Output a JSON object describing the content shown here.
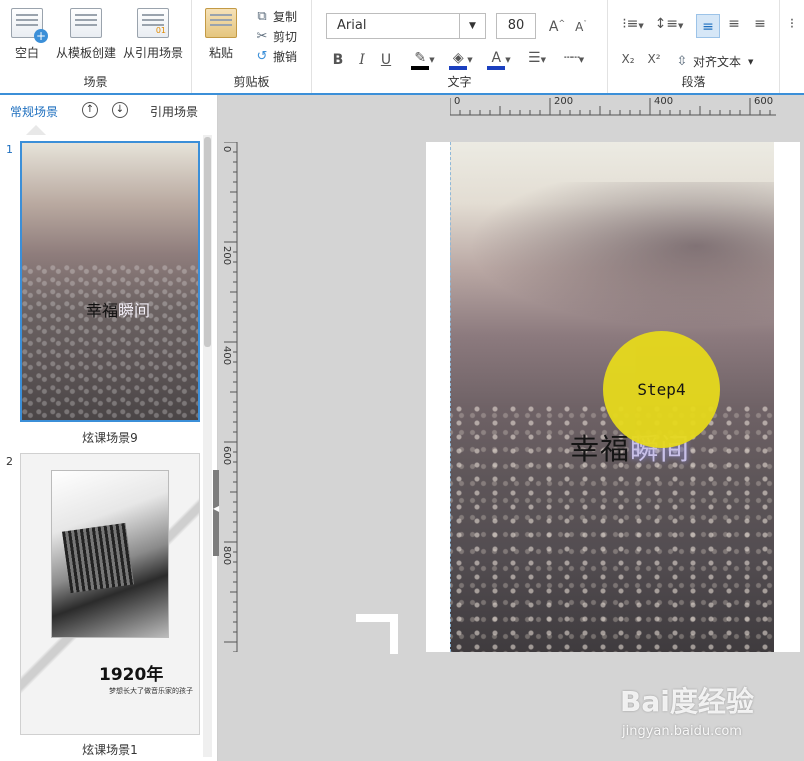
{
  "ribbon": {
    "scene_group": {
      "title": "场景",
      "buttons": [
        {
          "label": "空白",
          "icon": "blank-page-icon"
        },
        {
          "label": "从模板创建",
          "icon": "template-icon"
        },
        {
          "label": "从引用场景",
          "icon": "reference-scene-icon"
        }
      ]
    },
    "clipboard_group": {
      "title": "剪贴板",
      "paste_label": "粘贴",
      "copy_label": "复制",
      "cut_label": "剪切",
      "undo_label": "撤销"
    },
    "text_group": {
      "title": "文字",
      "font_family": "Arial",
      "font_size": "80",
      "bold": "B",
      "italic": "I",
      "underline": "U",
      "highlight_color": "#000000",
      "fill_color": "#1a3fbf",
      "font_color": "#1a3fbf"
    },
    "paragraph_group": {
      "title": "段落",
      "align_text_label": "对齐文本"
    }
  },
  "left_panel": {
    "tab_normal": "常规场景",
    "tab_reference": "引用场景",
    "scenes": [
      {
        "number": "1",
        "title": "炫课场景9",
        "text_dark": "幸福",
        "text_light": "瞬间"
      },
      {
        "number": "2",
        "title": "炫课场景1",
        "year": "1920年",
        "caption": "梦想长大了做音乐家的孩子"
      }
    ]
  },
  "canvas": {
    "ruler_top_labels": [
      "0",
      "200",
      "400",
      "600"
    ],
    "ruler_left_labels": [
      "0",
      "200",
      "400",
      "600",
      "800"
    ],
    "headline_dark": "幸福",
    "headline_light": "瞬间",
    "step_label": "Step4",
    "step_color": "#e6d91c"
  },
  "watermark": {
    "brand": "Bai度经验",
    "url": "jingyan.baidu.com"
  }
}
